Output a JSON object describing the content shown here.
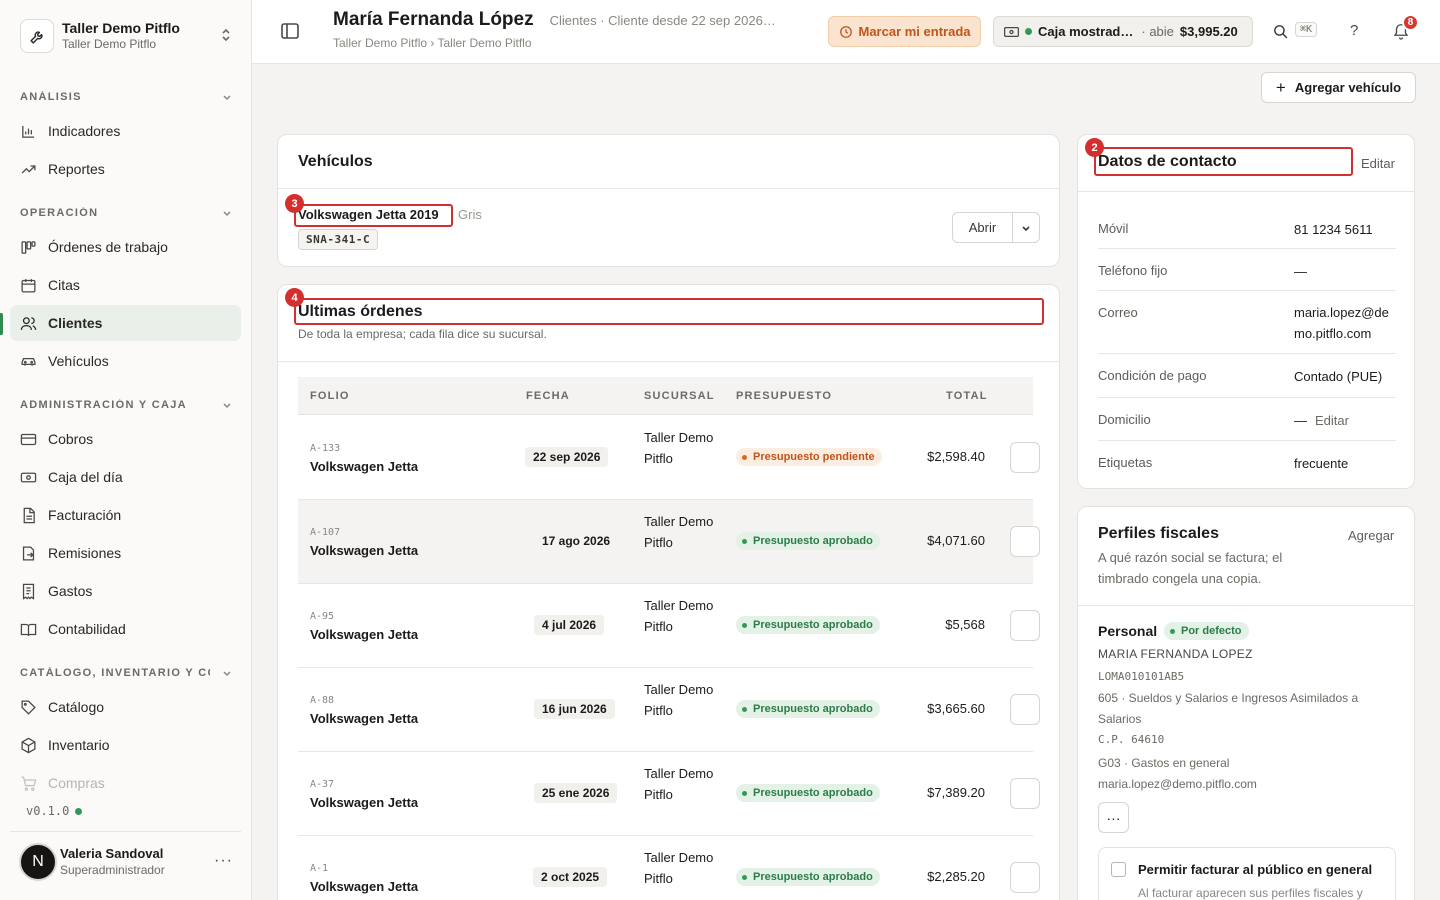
{
  "workspace": {
    "name": "Taller Demo Pitflo",
    "sub": "Taller Demo Pitflo"
  },
  "sidebar": {
    "sections": [
      {
        "label": "ANÁLISIS"
      },
      {
        "label": "OPERACIÓN"
      },
      {
        "label": "ADMINISTRACIÓN Y CAJA"
      },
      {
        "label": "CATÁLOGO, INVENTARIO Y CO…"
      }
    ],
    "items": [
      {
        "label": "Indicadores",
        "icon": "bar-chart-icon"
      },
      {
        "label": "Reportes",
        "icon": "trend-icon"
      },
      {
        "label": "Órdenes de trabajo",
        "icon": "work-orders-icon"
      },
      {
        "label": "Citas",
        "icon": "calendar-icon"
      },
      {
        "label": "Clientes",
        "icon": "users-icon",
        "active": true
      },
      {
        "label": "Vehículos",
        "icon": "car-icon"
      },
      {
        "label": "Cobros",
        "icon": "card-icon"
      },
      {
        "label": "Caja del día",
        "icon": "cash-icon"
      },
      {
        "label": "Facturación",
        "icon": "invoice-icon"
      },
      {
        "label": "Remisiones",
        "icon": "remission-icon"
      },
      {
        "label": "Gastos",
        "icon": "receipt-icon"
      },
      {
        "label": "Contabilidad",
        "icon": "book-icon"
      },
      {
        "label": "Catálogo",
        "icon": "tag-icon"
      },
      {
        "label": "Inventario",
        "icon": "box-icon"
      },
      {
        "label": "Compras",
        "icon": "cart-icon"
      }
    ],
    "version": "v0.1.0",
    "user": {
      "initial": "N",
      "name": "Valeria Sandoval",
      "role": "Superadministrador"
    }
  },
  "header": {
    "title": "María Fernanda López",
    "meta": "Clientes · Cliente desde 22 sep 2026…",
    "breadcrumb": "Taller Demo Pitflo › Taller Demo Pitflo",
    "clock_in_label": "Marcar mi entrada",
    "register": {
      "name": "Caja mostrad…",
      "status": "· abie",
      "amount": "$3,995.20"
    },
    "search_shortcut": "⌘K",
    "help": "?",
    "notifications": "8"
  },
  "actions": {
    "add_vehicle": "Agregar vehículo"
  },
  "vehicles": {
    "title": "Vehículos",
    "marker": "3",
    "items": [
      {
        "name": "Volkswagen Jetta 2019",
        "color": "Gris",
        "plate": "SNA-341-C",
        "open_label": "Abrir"
      }
    ]
  },
  "orders": {
    "title": "Ultimas órdenes",
    "marker": "4",
    "subtitle": "De toda la empresa; cada fila dice su sucursal.",
    "columns": [
      "FOLIO",
      "FECHA",
      "SUCURSAL",
      "PRESUPUESTO",
      "TOTAL"
    ],
    "rows": [
      {
        "folio": "A-133",
        "vehicle": "Volkswagen Jetta",
        "date": "22 sep 2026",
        "branch": "Taller Demo Pitflo",
        "budget": "Presupuesto pendiente",
        "status": "pending",
        "total": "$2,598.40"
      },
      {
        "folio": "A-107",
        "vehicle": "Volkswagen Jetta",
        "date": "17 ago 2026",
        "branch": "Taller Demo Pitflo",
        "budget": "Presupuesto aprobado",
        "status": "approved",
        "total": "$4,071.60"
      },
      {
        "folio": "A-95",
        "vehicle": "Volkswagen Jetta",
        "date": "4 jul 2026",
        "branch": "Taller Demo Pitflo",
        "budget": "Presupuesto aprobado",
        "status": "approved",
        "total": "$5,568"
      },
      {
        "folio": "A-88",
        "vehicle": "Volkswagen Jetta",
        "date": "16 jun 2026",
        "branch": "Taller Demo Pitflo",
        "budget": "Presupuesto aprobado",
        "status": "approved",
        "total": "$3,665.60"
      },
      {
        "folio": "A-37",
        "vehicle": "Volkswagen Jetta",
        "date": "25 ene 2026",
        "branch": "Taller Demo Pitflo",
        "budget": "Presupuesto aprobado",
        "status": "approved",
        "total": "$7,389.20"
      },
      {
        "folio": "A-1",
        "vehicle": "Volkswagen Jetta",
        "date": "2 oct 2025",
        "branch": "Taller Demo Pitflo",
        "budget": "Presupuesto aprobado",
        "status": "approved",
        "total": "$2,285.20"
      }
    ]
  },
  "contact": {
    "title": "Datos de contacto",
    "marker": "2",
    "edit_label": "Editar",
    "fields": [
      {
        "label": "Móvil",
        "value": "81 1234 5611"
      },
      {
        "label": "Teléfono fijo",
        "value": "—"
      },
      {
        "label": "Correo",
        "value": "maria.lopez@demo.pitflo.com"
      },
      {
        "label": "Condición de pago",
        "value": "Contado (PUE)"
      },
      {
        "label": "Domicilio",
        "value": "—",
        "edit": "Editar"
      },
      {
        "label": "Etiquetas",
        "value": "frecuente"
      }
    ]
  },
  "fiscal": {
    "title": "Perfiles fiscales",
    "add_label": "Agregar",
    "subtitle": "A qué razón social se factura; el timbrado congela una copia.",
    "profile": {
      "name": "Personal",
      "default_badge": "Por defecto",
      "legal_name": "MARIA FERNANDA LOPEZ",
      "rfc": "LOMA010101AB5",
      "regime": "605 · Sueldos y Salarios e Ingresos Asimilados a Salarios",
      "zip": "C.P. 64610",
      "use": "G03 · Gastos en general",
      "email": "maria.lopez@demo.pitflo.com",
      "more": "···"
    },
    "public_invoice": {
      "label": "Permitir facturar al público en general",
      "hint": "Al facturar aparecen sus perfiles fiscales y"
    }
  }
}
